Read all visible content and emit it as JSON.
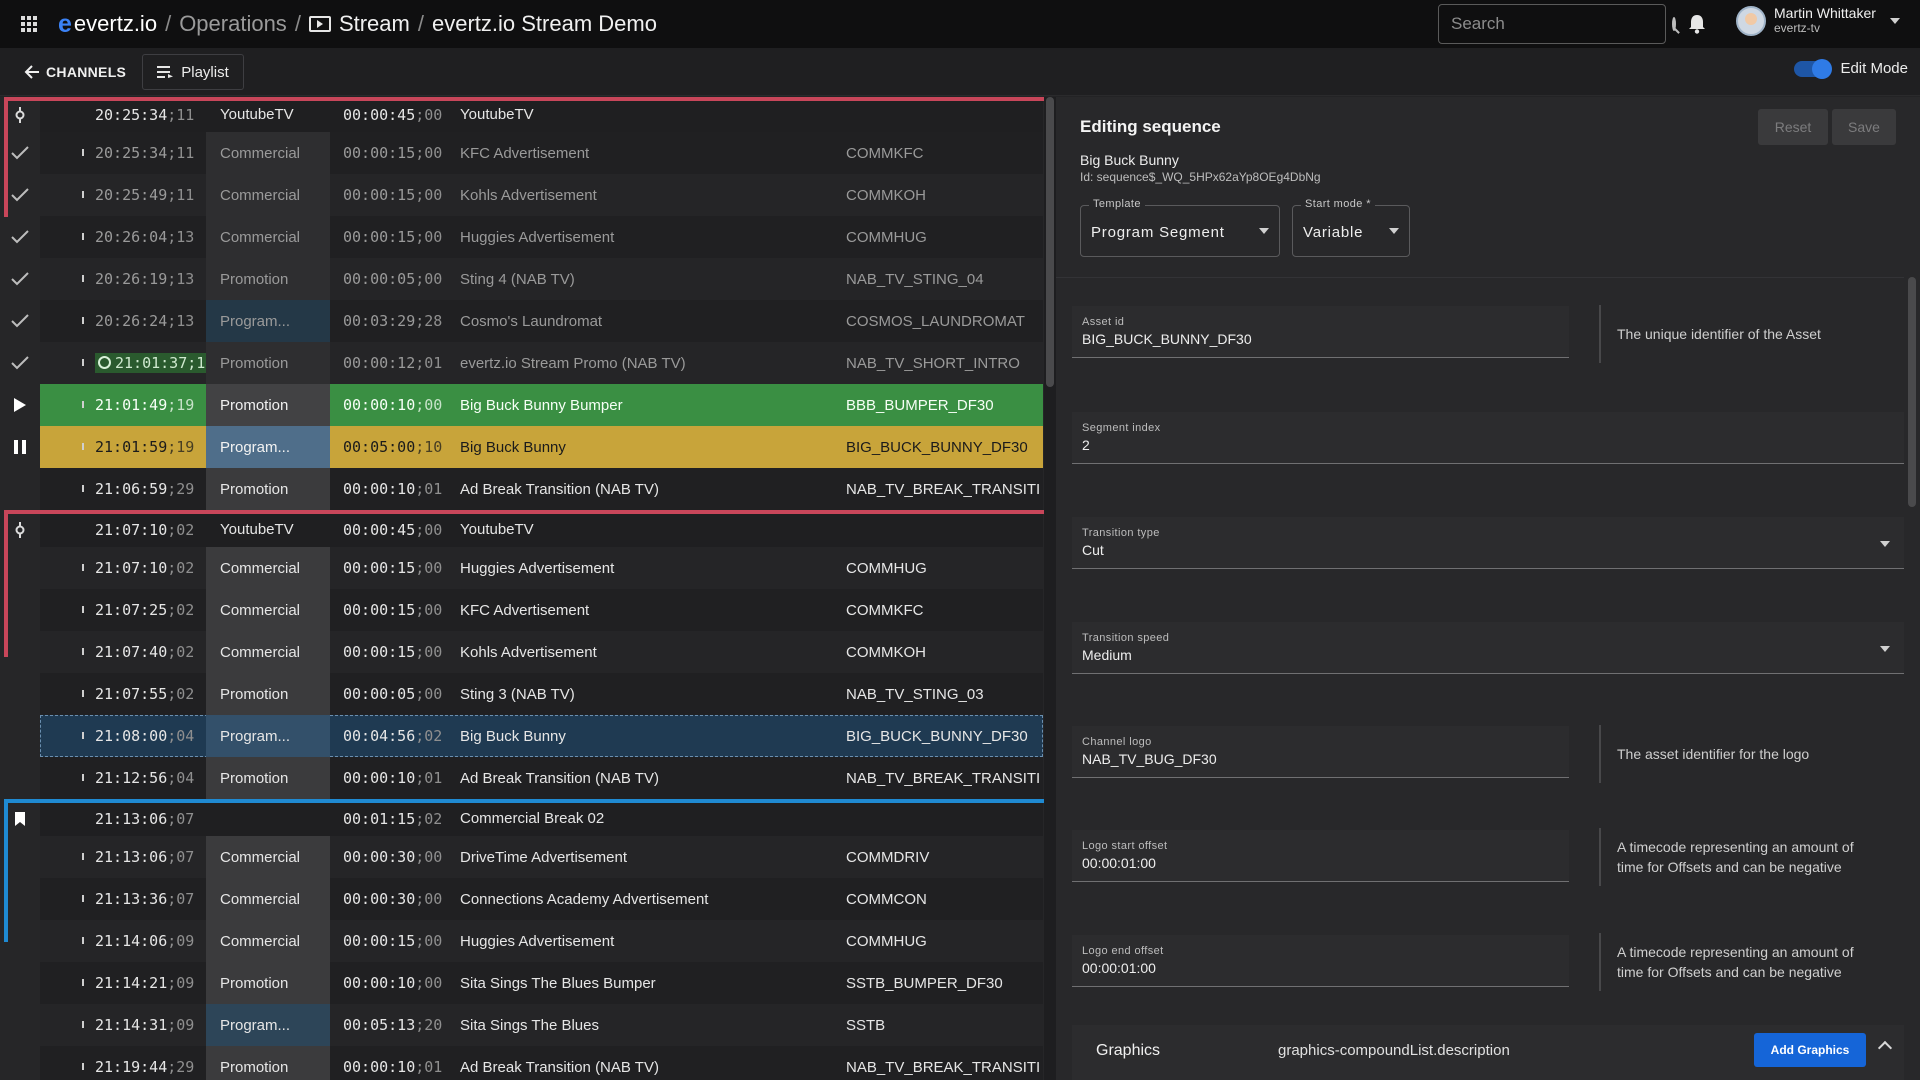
{
  "topbar": {
    "brand": "evertz.io",
    "breadcrumbs": [
      "Operations",
      "Stream",
      "evertz.io Stream Demo"
    ],
    "search_placeholder": "Search",
    "user_name": "Martin Whittaker",
    "user_org": "evertz-tv"
  },
  "subbar": {
    "back_label": "CHANNELS",
    "playlist_label": "Playlist",
    "edit_mode_label": "Edit Mode",
    "edit_mode_on": true
  },
  "playlist": {
    "rows": [
      {
        "kind": "header",
        "status": "pin",
        "time": "20:25:34",
        "frames": "11",
        "type": "YoutubeTV",
        "dur": "00:00:45",
        "dframes": "00",
        "title": "YoutubeTV",
        "id": ""
      },
      {
        "kind": "done",
        "status": "check",
        "time": "20:25:34",
        "frames": "11",
        "type": "Commercial",
        "dur": "00:00:15",
        "dframes": "00",
        "title": "KFC Advertisement",
        "id": "COMMKFC"
      },
      {
        "kind": "done",
        "status": "check",
        "time": "20:25:49",
        "frames": "11",
        "type": "Commercial",
        "dur": "00:00:15",
        "dframes": "00",
        "title": "Kohls Advertisement",
        "id": "COMMKOH"
      },
      {
        "kind": "done",
        "status": "check",
        "time": "20:26:04",
        "frames": "13",
        "type": "Commercial",
        "dur": "00:00:15",
        "dframes": "00",
        "title": "Huggies Advertisement",
        "id": "COMMHUG"
      },
      {
        "kind": "done",
        "status": "check",
        "time": "20:26:19",
        "frames": "13",
        "type": "Promotion",
        "dur": "00:00:05",
        "dframes": "00",
        "title": "Sting 4 (NAB TV)",
        "id": "NAB_TV_STING_04"
      },
      {
        "kind": "done",
        "status": "check",
        "time": "20:26:24",
        "frames": "13",
        "type": "Program...",
        "dur": "00:03:29",
        "dframes": "28",
        "title": "Cosmo's Laundromat",
        "id": "COSMOS_LAUNDROMAT"
      },
      {
        "kind": "done",
        "status": "check",
        "time": "21:01:37",
        "frames": "18",
        "type": "Promotion",
        "dur": "00:00:12",
        "dframes": "01",
        "title": "evertz.io Stream Promo (NAB TV)",
        "id": "NAB_TV_SHORT_INTRO",
        "clock": true
      },
      {
        "kind": "playing",
        "status": "play",
        "time": "21:01:49",
        "frames": "19",
        "type": "Promotion",
        "dur": "00:00:10",
        "dframes": "00",
        "title": "Big Buck Bunny Bumper",
        "id": "BBB_BUMPER_DF30"
      },
      {
        "kind": "cued",
        "status": "pause",
        "time": "21:01:59",
        "frames": "19",
        "type": "Program...",
        "dur": "00:05:00",
        "dframes": "10",
        "title": "Big Buck Bunny",
        "id": "BIG_BUCK_BUNNY_DF30"
      },
      {
        "kind": "normal",
        "status": "",
        "time": "21:06:59",
        "frames": "29",
        "type": "Promotion",
        "dur": "00:00:10",
        "dframes": "01",
        "title": "Ad Break Transition (NAB TV)",
        "id": "NAB_TV_BREAK_TRANSITI..."
      },
      {
        "kind": "header",
        "status": "pin",
        "time": "21:07:10",
        "frames": "02",
        "type": "YoutubeTV",
        "dur": "00:00:45",
        "dframes": "00",
        "title": "YoutubeTV",
        "id": ""
      },
      {
        "kind": "normal",
        "status": "",
        "time": "21:07:10",
        "frames": "02",
        "type": "Commercial",
        "dur": "00:00:15",
        "dframes": "00",
        "title": "Huggies Advertisement",
        "id": "COMMHUG"
      },
      {
        "kind": "normal",
        "status": "",
        "time": "21:07:25",
        "frames": "02",
        "type": "Commercial",
        "dur": "00:00:15",
        "dframes": "00",
        "title": "KFC Advertisement",
        "id": "COMMKFC"
      },
      {
        "kind": "normal",
        "status": "",
        "time": "21:07:40",
        "frames": "02",
        "type": "Commercial",
        "dur": "00:00:15",
        "dframes": "00",
        "title": "Kohls Advertisement",
        "id": "COMMKOH"
      },
      {
        "kind": "normal",
        "status": "",
        "time": "21:07:55",
        "frames": "02",
        "type": "Promotion",
        "dur": "00:00:05",
        "dframes": "00",
        "title": "Sting 3 (NAB TV)",
        "id": "NAB_TV_STING_03"
      },
      {
        "kind": "selected",
        "status": "",
        "time": "21:08:00",
        "frames": "04",
        "type": "Program...",
        "dur": "00:04:56",
        "dframes": "02",
        "title": "Big Buck Bunny",
        "id": "BIG_BUCK_BUNNY_DF30"
      },
      {
        "kind": "normal",
        "status": "",
        "time": "21:12:56",
        "frames": "04",
        "type": "Promotion",
        "dur": "00:00:10",
        "dframes": "01",
        "title": "Ad Break Transition (NAB TV)",
        "id": "NAB_TV_BREAK_TRANSITI..."
      },
      {
        "kind": "header",
        "status": "bookmark",
        "time": "21:13:06",
        "frames": "07",
        "type": "",
        "dur": "00:01:15",
        "dframes": "02",
        "title": "Commercial Break 02",
        "id": ""
      },
      {
        "kind": "normal",
        "status": "",
        "time": "21:13:06",
        "frames": "07",
        "type": "Commercial",
        "dur": "00:00:30",
        "dframes": "00",
        "title": "DriveTime Advertisement",
        "id": "COMMDRIV"
      },
      {
        "kind": "normal",
        "status": "",
        "time": "21:13:36",
        "frames": "07",
        "type": "Commercial",
        "dur": "00:00:30",
        "dframes": "00",
        "title": "Connections Academy Advertisement",
        "id": "COMMCON"
      },
      {
        "kind": "normal",
        "status": "",
        "time": "21:14:06",
        "frames": "09",
        "type": "Commercial",
        "dur": "00:00:15",
        "dframes": "00",
        "title": "Huggies Advertisement",
        "id": "COMMHUG"
      },
      {
        "kind": "normal",
        "status": "",
        "time": "21:14:21",
        "frames": "09",
        "type": "Promotion",
        "dur": "00:00:10",
        "dframes": "00",
        "title": "Sita Sings The Blues Bumper",
        "id": "SSTB_BUMPER_DF30"
      },
      {
        "kind": "normal",
        "status": "",
        "time": "21:14:31",
        "frames": "09",
        "type": "Program...",
        "dur": "00:05:13",
        "dframes": "20",
        "title": "Sita Sings The Blues",
        "id": "SSTB"
      },
      {
        "kind": "normal",
        "status": "",
        "time": "21:19:44",
        "frames": "29",
        "type": "Promotion",
        "dur": "00:00:10",
        "dframes": "01",
        "title": "Ad Break Transition (NAB TV)",
        "id": "NAB_TV_BREAK_TRANSITI..."
      }
    ]
  },
  "panel": {
    "title": "Editing sequence",
    "reset_label": "Reset",
    "save_label": "Save",
    "asset_name": "Big Buck Bunny",
    "asset_id_line": "Id: sequence$_WQ_5HPx62aYp8OEg4DbNg",
    "template_label": "Template",
    "template_value": "Program Segment",
    "start_mode_label": "Start mode *",
    "start_mode_value": "Variable",
    "asset_id_label": "Asset id",
    "asset_id_value": "BIG_BUCK_BUNNY_DF30",
    "asset_id_help": "The unique identifier of the Asset",
    "segment_index_label": "Segment index",
    "segment_index_value": "2",
    "transition_type_label": "Transition type",
    "transition_type_value": "Cut",
    "transition_speed_label": "Transition speed",
    "transition_speed_value": "Medium",
    "channel_logo_label": "Channel logo",
    "channel_logo_value": "NAB_TV_BUG_DF30",
    "channel_logo_help": "The asset identifier for the logo",
    "logo_start_label": "Logo start offset",
    "logo_start_value": "00:00:01:00",
    "logo_start_help": "A timecode representing an amount of time for Offsets and can be negative",
    "logo_end_label": "Logo end offset",
    "logo_end_value": "00:00:01:00",
    "logo_end_help": "A timecode representing an amount of time for Offsets and can be negative",
    "graphics_title": "Graphics",
    "graphics_desc": "graphics-compoundList.description",
    "add_graphics_label": "Add Graphics"
  },
  "colors": {
    "playing": "#3a8f43",
    "cued": "#c8a43a",
    "selected": "#1f3a52",
    "group_red": "#c8465a",
    "group_blue": "#1f8ad2",
    "accent": "#1565d8"
  }
}
